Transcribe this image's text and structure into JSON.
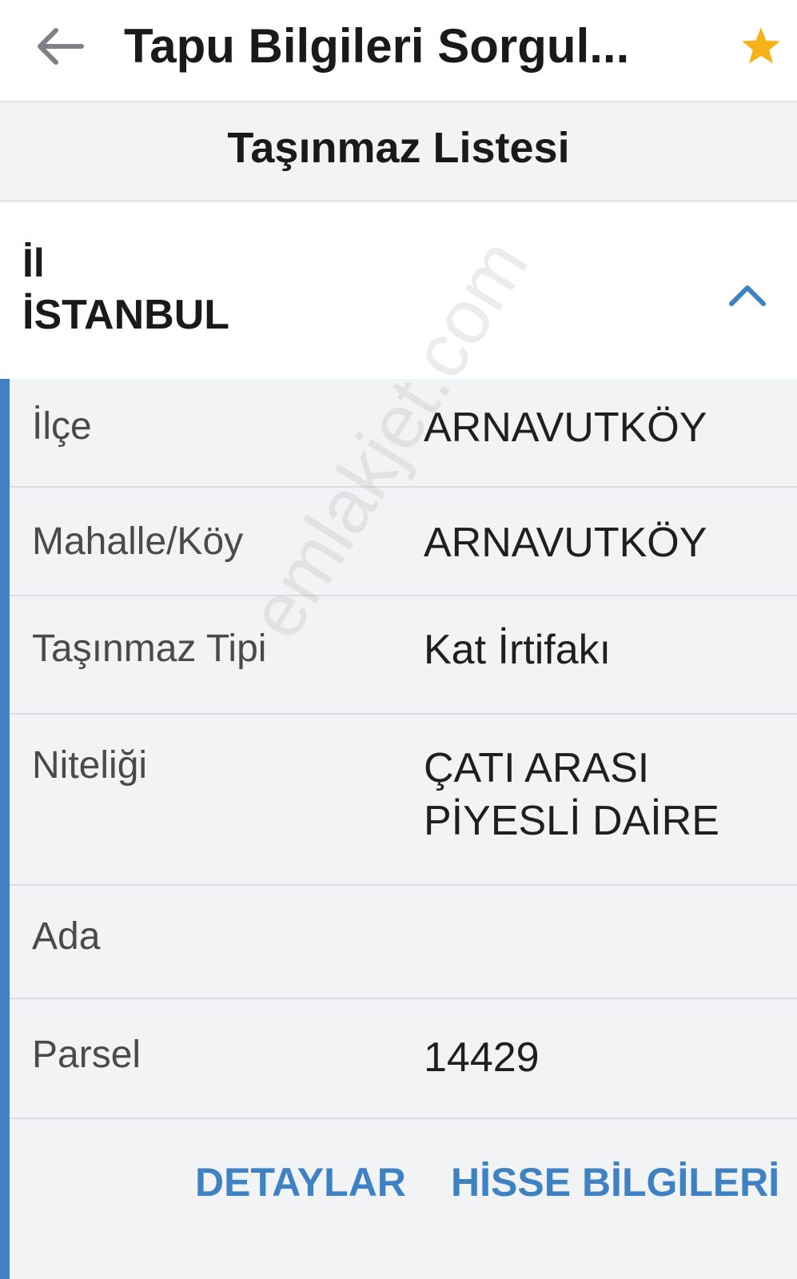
{
  "topbar": {
    "title": "Tapu Bilgileri Sorgul...",
    "back_icon": "arrow-left-icon",
    "favorite_icon": "star-icon",
    "favorite_color": "#f7b21a"
  },
  "section": {
    "title": "Taşınmaz Listesi"
  },
  "card": {
    "il_label": "İl",
    "il_value": "İSTANBUL",
    "collapse_icon": "chevron-up-icon"
  },
  "details": [
    {
      "label": "İlçe",
      "value": "ARNAVUTKÖY"
    },
    {
      "label": "Mahalle/Köy",
      "value": "ARNAVUTKÖY"
    },
    {
      "label": "Taşınmaz Tipi",
      "value": "Kat İrtifakı"
    },
    {
      "label": "Niteliği",
      "value": "ÇATI ARASI PİYESLİ DAİRE"
    },
    {
      "label": "Ada",
      "value": ""
    },
    {
      "label": "Parsel",
      "value": "14429"
    }
  ],
  "actions": {
    "details_label": "DETAYLAR",
    "share_info_label": "HİSSE BİLGİLERİ"
  },
  "watermark": "emlakjet.com",
  "colors": {
    "accent": "#3f82c4",
    "background": "#f2f3f5",
    "surface": "#ffffff"
  }
}
